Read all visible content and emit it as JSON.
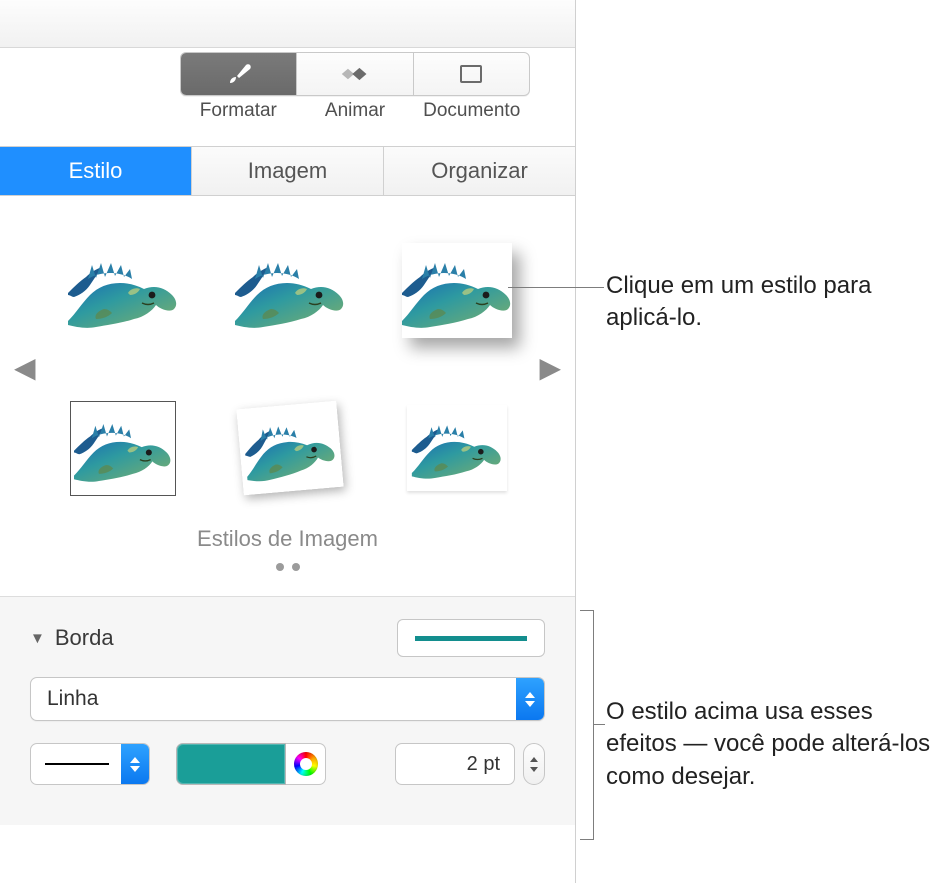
{
  "toolbar": {
    "format_label": "Formatar",
    "animate_label": "Animar",
    "document_label": "Documento"
  },
  "subtabs": {
    "style": "Estilo",
    "image": "Imagem",
    "arrange": "Organizar"
  },
  "gallery": {
    "title": "Estilos de Imagem"
  },
  "border": {
    "title": "Borda",
    "type_label": "Linha",
    "width_value": "2 pt",
    "color_hex": "#1a9e98"
  },
  "callouts": {
    "style_click": "Clique em um estilo para aplicá-lo.",
    "effects_edit": "O estilo acima usa esses efeitos — você pode alterá-los como desejar."
  }
}
